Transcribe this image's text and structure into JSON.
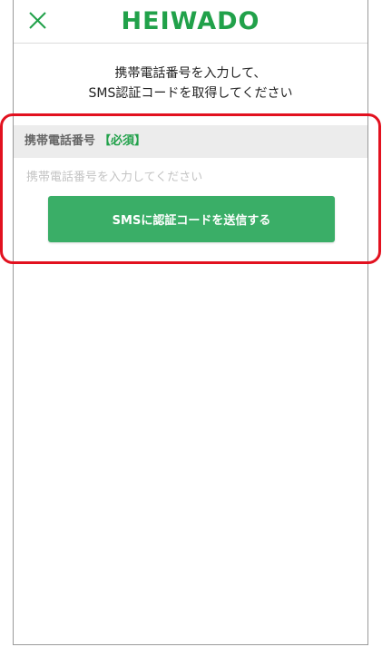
{
  "header": {
    "close_icon": "close-icon",
    "logo_text": "HEIWADO"
  },
  "instruction": {
    "line1": "携帯電話番号を入力して、",
    "line2": "SMS認証コードを取得してください"
  },
  "form": {
    "label": "携帯電話番号",
    "required": "【必須】",
    "placeholder": "携帯電話番号を入力してください",
    "value": ""
  },
  "send_button": {
    "label": "SMSに認証コードを送信する"
  },
  "colors": {
    "brand_green": "#21a14a",
    "button_green": "#3aae67",
    "highlight_red": "#e2111f"
  }
}
